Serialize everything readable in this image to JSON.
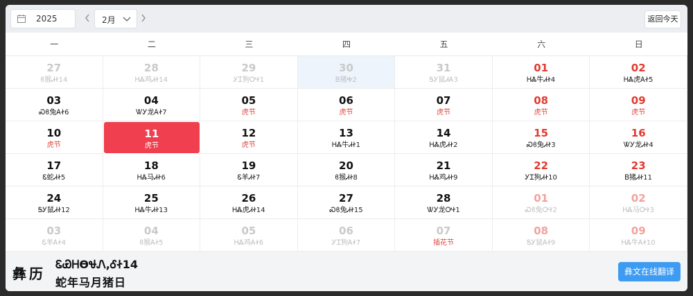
{
  "toolbar": {
    "year": "2025",
    "month": "2月",
    "today_label": "返回今天"
  },
  "weekdays": [
    "一",
    "二",
    "三",
    "四",
    "五",
    "六",
    "日"
  ],
  "weeks": [
    [
      {
        "day": "27",
        "sub": "ϐ猴ᏗᏐ14",
        "style": "c-faded"
      },
      {
        "day": "28",
        "sub": "ᎻᏜ鸡ᏗᏐ14",
        "style": "c-faded"
      },
      {
        "day": "29",
        "sub": "ᎩᏆ狗ᎤᏐ1",
        "style": "c-faded"
      },
      {
        "day": "30",
        "sub": "Ᏼ猪Ꭽ2",
        "style": "c-faded c-hl"
      },
      {
        "day": "31",
        "sub": "ᎦᎩ鼠ᏗᎪ3",
        "style": "c-faded"
      },
      {
        "day": "01",
        "sub": "ᎻᏜ牛ᏗᏐ4",
        "style": "c-red"
      },
      {
        "day": "02",
        "sub": "ᎻᏜ虎ᎪᏐ5",
        "style": "c-red"
      }
    ],
    [
      {
        "day": "03",
        "sub": "Ꮝϐ兔ᎪᏐ6",
        "style": "c-black"
      },
      {
        "day": "04",
        "sub": "ᏔᎩ龙ᎪᏐ7",
        "style": "c-black"
      },
      {
        "day": "05",
        "sub": "虎节",
        "style": "c-black c-fest"
      },
      {
        "day": "06",
        "sub": "虎节",
        "style": "c-black c-fest"
      },
      {
        "day": "07",
        "sub": "虎节",
        "style": "c-black c-fest"
      },
      {
        "day": "08",
        "sub": "虎节",
        "style": "c-red c-fest"
      },
      {
        "day": "09",
        "sub": "虎节",
        "style": "c-red c-fest"
      }
    ],
    [
      {
        "day": "10",
        "sub": "虎节",
        "style": "c-black c-fest"
      },
      {
        "day": "11",
        "sub": "虎节",
        "style": "c-sel"
      },
      {
        "day": "12",
        "sub": "虎节",
        "style": "c-black c-fest"
      },
      {
        "day": "13",
        "sub": "ᎻᏜ牛ᏗᏐ1",
        "style": "c-black"
      },
      {
        "day": "14",
        "sub": "ᎻᏜ虎ᏗᏐ2",
        "style": "c-black"
      },
      {
        "day": "15",
        "sub": "Ꮝϐ兔ᏗᏐ3",
        "style": "c-red"
      },
      {
        "day": "16",
        "sub": "ᏔᎩ龙ᏗᏐ4",
        "style": "c-red"
      }
    ],
    [
      {
        "day": "17",
        "sub": "Ꮛ蛇ᏗᏐ5",
        "style": "c-black"
      },
      {
        "day": "18",
        "sub": "ᎻᏜ马ᏗᏐ6",
        "style": "c-black"
      },
      {
        "day": "19",
        "sub": "Ꮛ羊ᏗᏐ7",
        "style": "c-black"
      },
      {
        "day": "20",
        "sub": "ϐ猴ᏗᏐ8",
        "style": "c-black"
      },
      {
        "day": "21",
        "sub": "ᎻᏜ鸡ᏗᏐ9",
        "style": "c-black"
      },
      {
        "day": "22",
        "sub": "ᎩᏆ狗ᏗᏐ10",
        "style": "c-red"
      },
      {
        "day": "23",
        "sub": "Ᏼ猪ᏗᏐ11",
        "style": "c-red"
      }
    ],
    [
      {
        "day": "24",
        "sub": "ᎦᎩ鼠ᏗᏐ12",
        "style": "c-black"
      },
      {
        "day": "25",
        "sub": "ᎻᏜ牛ᏗᏐ13",
        "style": "c-black"
      },
      {
        "day": "26",
        "sub": "ᎻᏜ虎ᏗᏐ14",
        "style": "c-black"
      },
      {
        "day": "27",
        "sub": "Ꮝϐ兔ᏗᏐ15",
        "style": "c-black"
      },
      {
        "day": "28",
        "sub": "ᏔᎩ龙ᎤᏐ1",
        "style": "c-black"
      },
      {
        "day": "01",
        "sub": "Ꮝϐ兔ᎤᏐ2",
        "style": "c-fadedred"
      },
      {
        "day": "02",
        "sub": "ᎻᏜ马ᎤᏐ3",
        "style": "c-fadedred"
      }
    ],
    [
      {
        "day": "03",
        "sub": "Ꮛ羊ᎪᏐ4",
        "style": "c-faded"
      },
      {
        "day": "04",
        "sub": "ϐ猴ᎪᏐ5",
        "style": "c-faded"
      },
      {
        "day": "05",
        "sub": "ᎻᏜ鸡ᎪᏐ6",
        "style": "c-faded"
      },
      {
        "day": "06",
        "sub": "ᎩᏆ狗ᎪᏐ7",
        "style": "c-faded"
      },
      {
        "day": "07",
        "sub": "插花节",
        "style": "c-faded c-fest"
      },
      {
        "day": "08",
        "sub": "ᎦᎩ鼠ᎪᏐ9",
        "style": "c-fadedred"
      },
      {
        "day": "09",
        "sub": "ᎻᏜ牛ᎪᏐ10",
        "style": "c-fadedred"
      }
    ]
  ],
  "footer": {
    "title": "彝历",
    "line1": "ᏋᏯᎻϴᏠᏁ,ᎴᏐ14",
    "line2": "蛇年马月猪日",
    "translate_label": "彝文在线翻译"
  }
}
